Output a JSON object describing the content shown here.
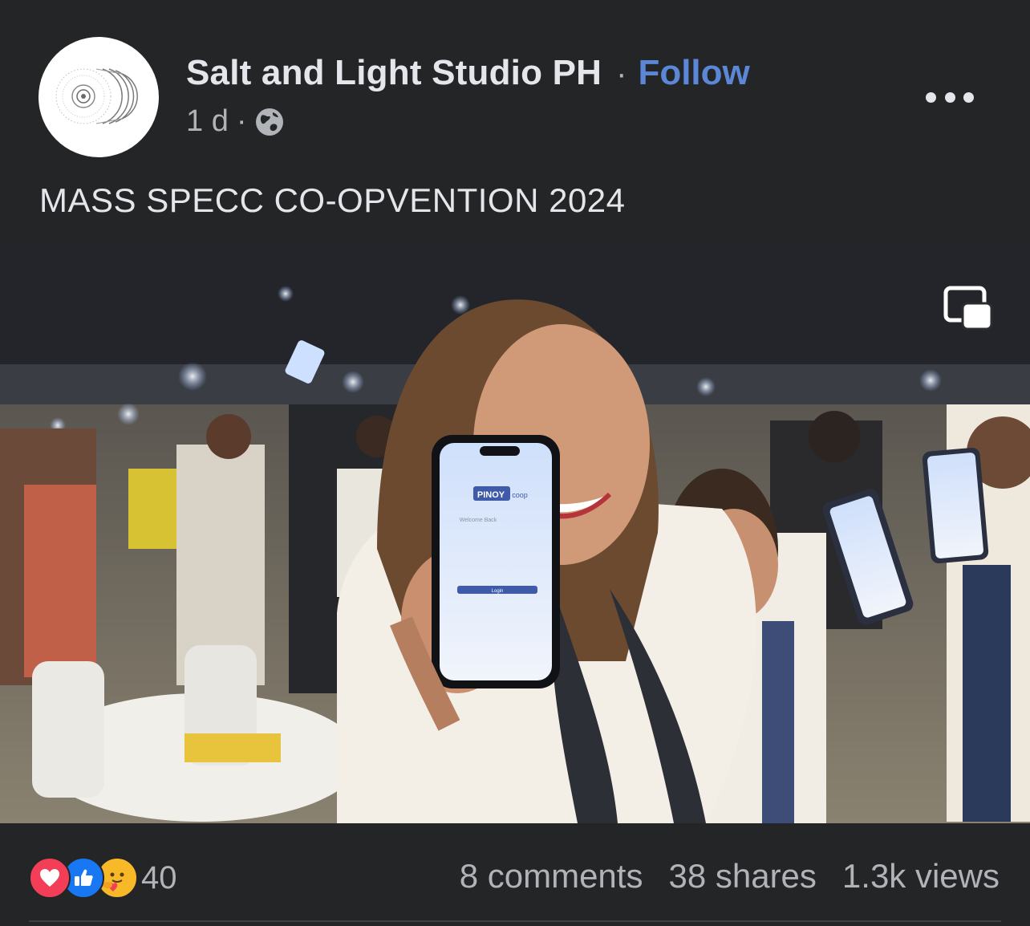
{
  "post": {
    "page_name": "Salt and Light Studio PH",
    "separator": "·",
    "follow_label": "Follow",
    "time": "1 d",
    "meta_separator": "·",
    "audience_icon": "globe-icon",
    "more_icon": "more-options-icon",
    "caption": "MASS SPECC CO-OPVENTION 2024"
  },
  "video": {
    "pip_icon": "picture-in-picture-icon",
    "phone_app_logo": "PINOY",
    "phone_app_logo_suffix": "coop",
    "phone_welcome": "Welcome Back",
    "phone_login_label": "Login"
  },
  "stats": {
    "reaction_icons": [
      "love-icon",
      "like-icon",
      "care-icon"
    ],
    "reaction_count": "40",
    "comments": "8 comments",
    "shares": "38 shares",
    "views": "1.3k views"
  },
  "colors": {
    "background": "#242526",
    "text_primary": "#e4e6eb",
    "text_secondary": "#b0b3b8",
    "follow_link": "#5b87d6",
    "love": "#f33e58",
    "like": "#1877f2",
    "care": "#f7b928"
  }
}
